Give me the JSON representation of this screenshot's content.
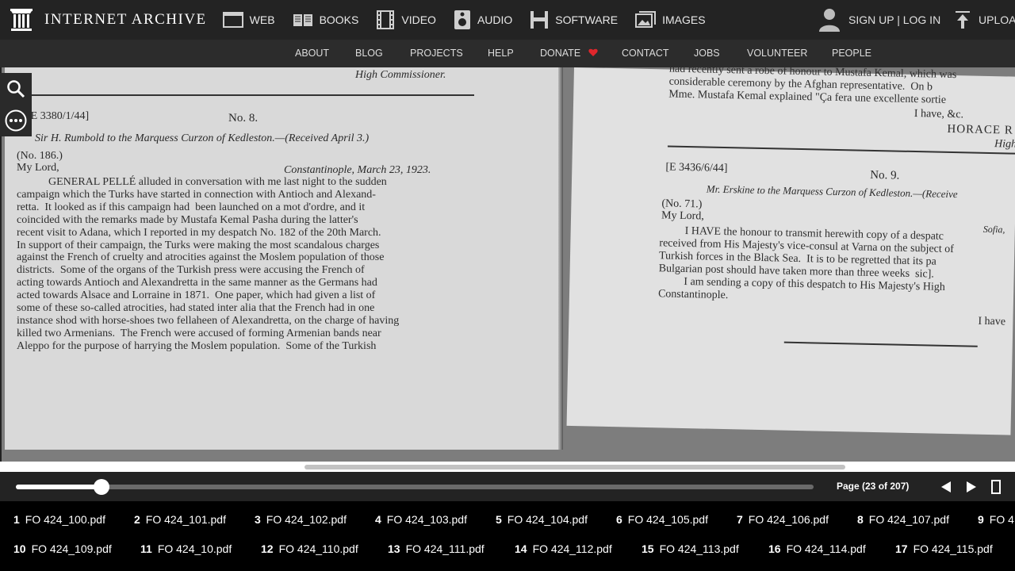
{
  "header": {
    "logo_text": "INTERNET ARCHIVE",
    "media": [
      {
        "label": "WEB",
        "icon": "web-icon"
      },
      {
        "label": "BOOKS",
        "icon": "books-icon"
      },
      {
        "label": "VIDEO",
        "icon": "video-icon"
      },
      {
        "label": "AUDIO",
        "icon": "audio-icon"
      },
      {
        "label": "SOFTWARE",
        "icon": "software-icon"
      },
      {
        "label": "IMAGES",
        "icon": "images-icon"
      }
    ],
    "signin": "SIGN UP | LOG IN",
    "upload": "UPLOAD"
  },
  "subnav": [
    "ABOUT",
    "BLOG",
    "PROJECTS",
    "HELP",
    "DONATE",
    "CONTACT",
    "JOBS",
    "VOLUNTEER",
    "PEOPLE"
  ],
  "colors": {
    "donate_heart": "#e0262c",
    "top_bg": "#232323",
    "subnav_bg": "#2c2c2c"
  },
  "document": {
    "left": {
      "signature": "High Commissioner.",
      "ref": "[E 3380/1/44]",
      "number": "No. 8.",
      "heading": "Sir H. Rumbold to the Marquess Curzon of Kedleston.—(Received April 3.)",
      "no": "(No. 186.)",
      "salutation": "My Lord,",
      "place_date": "Constantinople, March 23, 1923.",
      "lines": [
        "GENERAL PELLÉ alluded in conversation with me last night to the sudden",
        "campaign which the Turks have started in connection with Antioch and Alexand-",
        "retta.  It looked as if this campaign had  been launched on a mot d'ordre, and it",
        "coincided with the remarks made by Mustafa Kemal Pasha during the latter's",
        "recent visit to Adana, which I reported in my despatch No. 182 of the 20th March.",
        "In support of their campaign, the Turks were making the most scandalous charges",
        "against the French of cruelty and atrocities against the Moslem population of those",
        "districts.  Some of the organs of the Turkish press were accusing the French of",
        "acting towards Antioch and Alexandretta in the same manner as the Germans had",
        "acted towards Alsace and Lorraine in 1871.  One paper, which had given a list of",
        "some of these so-called atrocities, had stated inter alia that the French had in one",
        "instance shod with horse-shoes two fellaheen of Alexandretta, on the charge of having",
        "killed two Armenians.  The French were accused of forming Armenian bands near",
        "Aleppo for the purpose of harrying the Moslem population.  Some of the Turkish"
      ]
    },
    "right": {
      "top_lines": [
        "had recently sent a robe of honour to Mustafa Kemal, which was",
        "considerable ceremony by the Afghan representative.  On b",
        "Mme. Mustafa Kemal explained \"Ça fera une excellente sortie"
      ],
      "closing": "I have, &c.",
      "signer": "HORACE R",
      "signer_title": "High",
      "ref": "[E 3436/6/44]",
      "number": "No. 9.",
      "heading": "Mr. Erskine to the Marquess Curzon of Kedleston.—(Receive",
      "no": "(No. 71.)",
      "salutation": "My Lord,",
      "place": "Sofia,",
      "lines": [
        "I HAVE the honour to transmit herewith copy of a despatc",
        "received from His Majesty's vice-consul at Varna on the subject of",
        "Turkish forces in the Black Sea.  It is to be regretted that its pa",
        "Bulgarian post should have taken more than three weeks  sic].",
        "I am sending a copy of this despatch to His Majesty's High",
        "Constantinople."
      ],
      "closing2": "I have"
    }
  },
  "viewer": {
    "page_label": "Page (23 of 207)",
    "progress": 0.107
  },
  "files": [
    {
      "num": "1",
      "name": "FO 424_100.pdf"
    },
    {
      "num": "2",
      "name": "FO 424_101.pdf"
    },
    {
      "num": "3",
      "name": "FO 424_102.pdf"
    },
    {
      "num": "4",
      "name": "FO 424_103.pdf"
    },
    {
      "num": "5",
      "name": "FO 424_104.pdf"
    },
    {
      "num": "6",
      "name": "FO 424_105.pdf"
    },
    {
      "num": "7",
      "name": "FO 424_106.pdf"
    },
    {
      "num": "8",
      "name": "FO 424_107.pdf"
    },
    {
      "num": "9",
      "name": "FO 4"
    },
    {
      "num": "10",
      "name": "FO 424_109.pdf"
    },
    {
      "num": "11",
      "name": "FO 424_10.pdf"
    },
    {
      "num": "12",
      "name": "FO 424_110.pdf"
    },
    {
      "num": "13",
      "name": "FO 424_111.pdf"
    },
    {
      "num": "14",
      "name": "FO 424_112.pdf"
    },
    {
      "num": "15",
      "name": "FO 424_113.pdf"
    },
    {
      "num": "16",
      "name": "FO 424_114.pdf"
    },
    {
      "num": "17",
      "name": "FO 424_115.pdf"
    }
  ]
}
